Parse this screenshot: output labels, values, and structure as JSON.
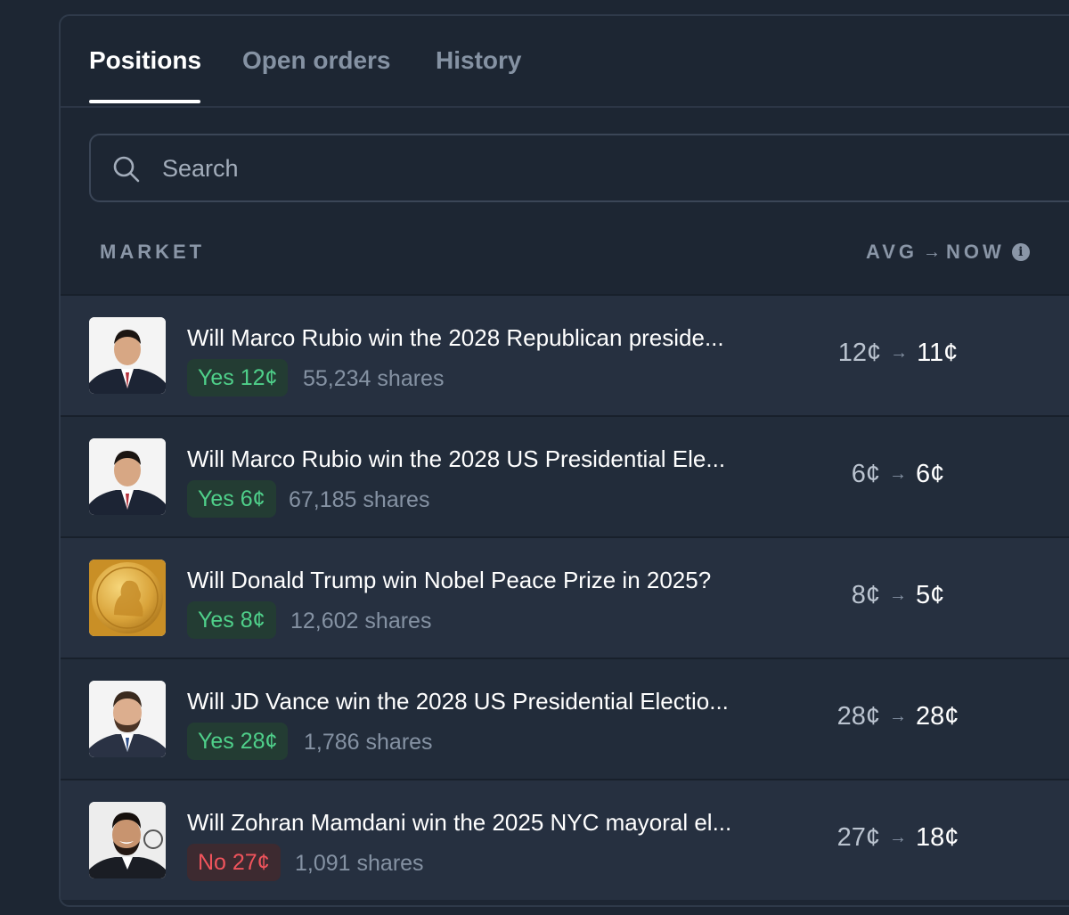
{
  "tabs": [
    {
      "label": "Positions",
      "active": true
    },
    {
      "label": "Open orders",
      "active": false
    },
    {
      "label": "History",
      "active": false
    }
  ],
  "search": {
    "placeholder": "Search"
  },
  "columns": {
    "market": "MARKET",
    "avg": "AVG",
    "arrow": "→",
    "now": "NOW",
    "info_icon": "info-icon"
  },
  "colors": {
    "yes": "#4fd08a",
    "no": "#f0545c",
    "background": "#1d2633"
  },
  "positions": [
    {
      "thumb": "marco-rubio-portrait",
      "title": "Will Marco Rubio win the 2028 Republican preside...",
      "badge": "Yes 12¢",
      "side": "yes",
      "shares": "55,234 shares",
      "avg": "12¢",
      "now": "11¢"
    },
    {
      "thumb": "marco-rubio-portrait",
      "title": "Will Marco Rubio win the 2028 US Presidential Ele...",
      "badge": "Yes 6¢",
      "side": "yes",
      "shares": "67,185 shares",
      "avg": "6¢",
      "now": "6¢"
    },
    {
      "thumb": "nobel-medal",
      "title": "Will Donald Trump win Nobel Peace Prize in 2025?",
      "badge": "Yes 8¢",
      "side": "yes",
      "shares": "12,602 shares",
      "avg": "8¢",
      "now": "5¢"
    },
    {
      "thumb": "jd-vance-portrait",
      "title": "Will JD Vance win the 2028 US Presidential Electio...",
      "badge": "Yes 28¢",
      "side": "yes",
      "shares": "1,786 shares",
      "avg": "28¢",
      "now": "28¢"
    },
    {
      "thumb": "zohran-mamdani-portrait",
      "title": "Will Zohran Mamdani win the 2025 NYC mayoral el...",
      "badge": "No 27¢",
      "side": "no",
      "shares": "1,091 shares",
      "avg": "27¢",
      "now": "18¢"
    }
  ]
}
